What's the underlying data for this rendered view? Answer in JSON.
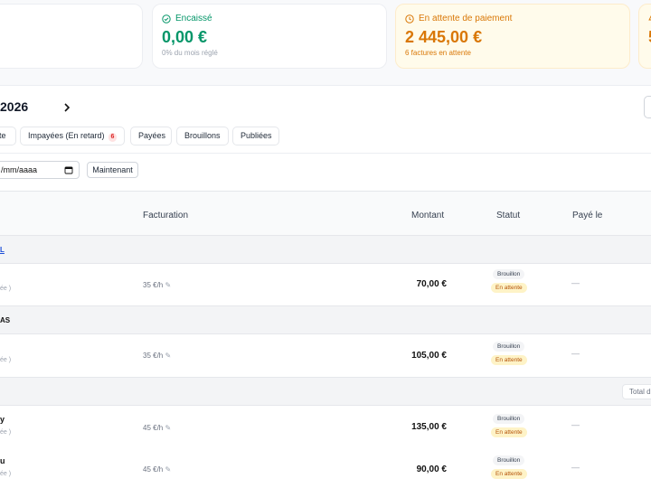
{
  "kpis": {
    "encaisse": {
      "label": "Encaissé",
      "value": "0,00 €",
      "sub": "0% du mois réglé",
      "icon": "check-circle-icon",
      "color": "#059669"
    },
    "attente": {
      "label": "En attente de paiement",
      "value": "2 445,00 €",
      "sub": "6 factures en attente",
      "icon": "clock-icon",
      "color": "#d97706"
    },
    "last_fragment": {
      "value": "5"
    }
  },
  "toolbar": {
    "period": "2026",
    "next_icon": "chevron-right-icon",
    "filters": [
      {
        "label": "te"
      },
      {
        "label": "Impayées (En retard)",
        "badge": "6"
      },
      {
        "label": "Payées"
      },
      {
        "label": "Brouillons"
      },
      {
        "label": "Publiées"
      }
    ],
    "date_value": "/mm/aaaa",
    "now_label": "Maintenant"
  },
  "table": {
    "headers": {
      "billing": "Facturation",
      "amount": "Montant",
      "status": "Statut",
      "paid": "Payé le"
    },
    "groups": [
      {
        "name": "L",
        "link": true
      },
      {
        "name": "AS",
        "link": false
      },
      {
        "name": "",
        "link": false,
        "total_label": "Total d"
      }
    ],
    "rows": [
      {
        "name": "",
        "note": "ée )",
        "rate": "35 €/h",
        "amount": "70,00 €",
        "status_draft": "Brouillon",
        "status_pending": "En attente",
        "paid": "—"
      },
      {
        "name": "",
        "note": "ée )",
        "rate": "35 €/h",
        "amount": "105,00 €",
        "status_draft": "Brouillon",
        "status_pending": "En attente",
        "paid": "—"
      },
      {
        "name": "y",
        "note": "ée )",
        "rate": "45 €/h",
        "amount": "135,00 €",
        "status_draft": "Brouillon",
        "status_pending": "En attente",
        "paid": "—"
      },
      {
        "name": "u",
        "note": "ée )",
        "rate": "45 €/h",
        "amount": "90,00 €",
        "status_draft": "Brouillon",
        "status_pending": "En attente",
        "paid": "—"
      }
    ]
  }
}
